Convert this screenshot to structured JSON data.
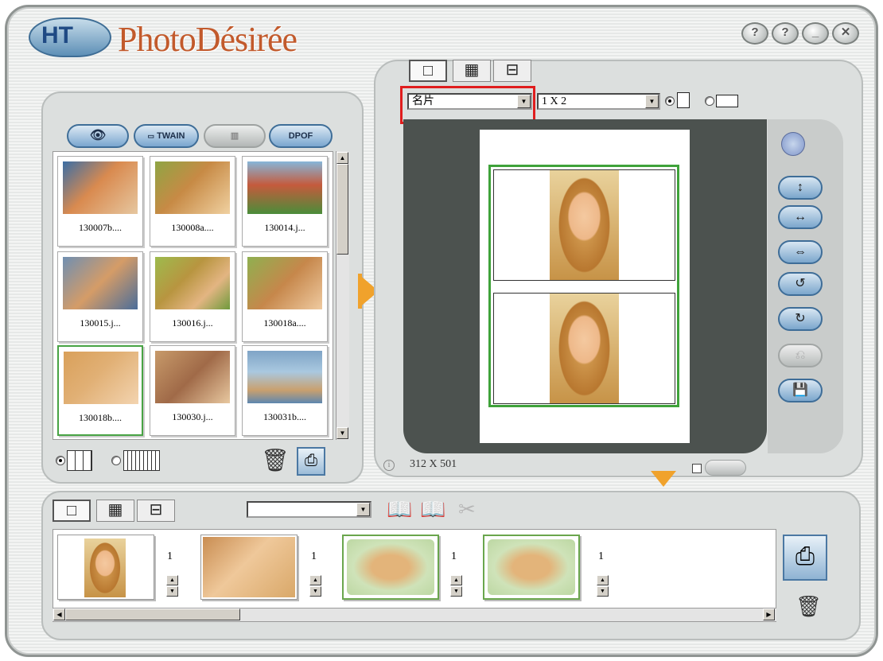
{
  "app": {
    "title_mark": "HT",
    "title": "PhotoDésirée",
    "top_buttons": [
      "?",
      "?",
      "_",
      "✕"
    ]
  },
  "browser": {
    "toolbar": {
      "open_icon": "eye-folder-icon",
      "twain_label": "TWAIN",
      "disabled_icon": "floppy-icon",
      "dpof_label": "DPOF"
    },
    "thumbnails": [
      {
        "caption": "130007b....",
        "tone": "#d98a4f"
      },
      {
        "caption": "130008a....",
        "tone": "#c78a45"
      },
      {
        "caption": "130014.j...",
        "tone": "#c55a3c"
      },
      {
        "caption": "130015.j...",
        "tone": "#6f8fb2"
      },
      {
        "caption": "130016.j...",
        "tone": "#b89540"
      },
      {
        "caption": "130018a....",
        "tone": "#c6874b"
      },
      {
        "caption": "130018b....",
        "tone": "#e1b075"
      },
      {
        "caption": "130030.j...",
        "tone": "#a06a48"
      },
      {
        "caption": "130031b....",
        "tone": "#7fa4c6"
      }
    ],
    "selected_index": 6,
    "grid_options": [
      "3-column-grid-icon",
      "dense-grid-icon"
    ]
  },
  "preview": {
    "view_tabs": [
      "single-page-icon",
      "grid-icon",
      "film-icon"
    ],
    "paper_type": "名片",
    "layout": "1 X 2",
    "orientation": [
      "portrait",
      "landscape"
    ],
    "size_readout": "312 X 501",
    "tools": [
      "fit-vertical-icon",
      "fit-horizontal-icon",
      "fit-both-icon",
      "rotate-left-icon",
      "rotate-right-icon",
      "undo-icon",
      "save-icon"
    ]
  },
  "tray": {
    "view_tabs": [
      "single-page-icon",
      "grid-icon",
      "film-icon"
    ],
    "dropdown_value": "",
    "book_icons": [
      "book-back-icon",
      "book-open-icon",
      "book-cut-icon"
    ],
    "items": [
      {
        "count": "1",
        "kind": "portrait"
      },
      {
        "count": "1",
        "kind": "landscape"
      },
      {
        "count": "1",
        "kind": "frame"
      },
      {
        "count": "1",
        "kind": "frame"
      }
    ]
  }
}
